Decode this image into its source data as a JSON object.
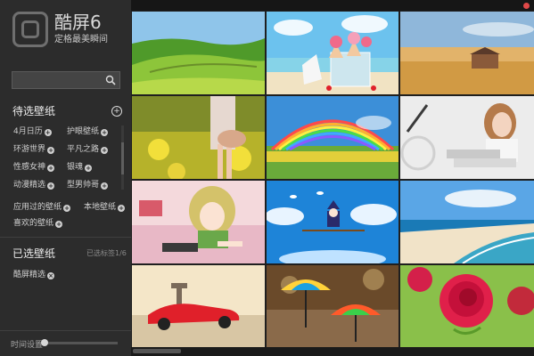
{
  "app": {
    "name": "酷屏6",
    "slogan": "定格最美瞬间"
  },
  "search": {
    "value": "",
    "placeholder": ""
  },
  "pending": {
    "title": "待选壁纸",
    "categories": [
      "4月日历",
      "护眼壁纸",
      "环游世界",
      "平凡之路",
      "性感女神",
      "银魂",
      "动漫精选",
      "型男帅哥"
    ],
    "applied_label": "应用过的壁纸",
    "local_label": "本地壁纸",
    "favorite_label": "喜欢的壁纸"
  },
  "selected": {
    "title": "已选壁纸",
    "count_text": "已选标签1/6",
    "items": [
      "酷屏精选"
    ]
  },
  "timer": {
    "label": "时间设置"
  },
  "colors": {
    "sidebar": "#2c2c2c",
    "main": "#1f1f1f",
    "close": "#e04848"
  },
  "wallpapers": [
    "green-hills",
    "ice-cream-beach",
    "barn-field",
    "yellow-flowers-girl",
    "rainbow-field",
    "girl-with-bicycle",
    "anime-girl-bedroom",
    "anime-witch-sky",
    "beach-waves",
    "red-sports-car",
    "umbrella-girls",
    "red-rose"
  ]
}
